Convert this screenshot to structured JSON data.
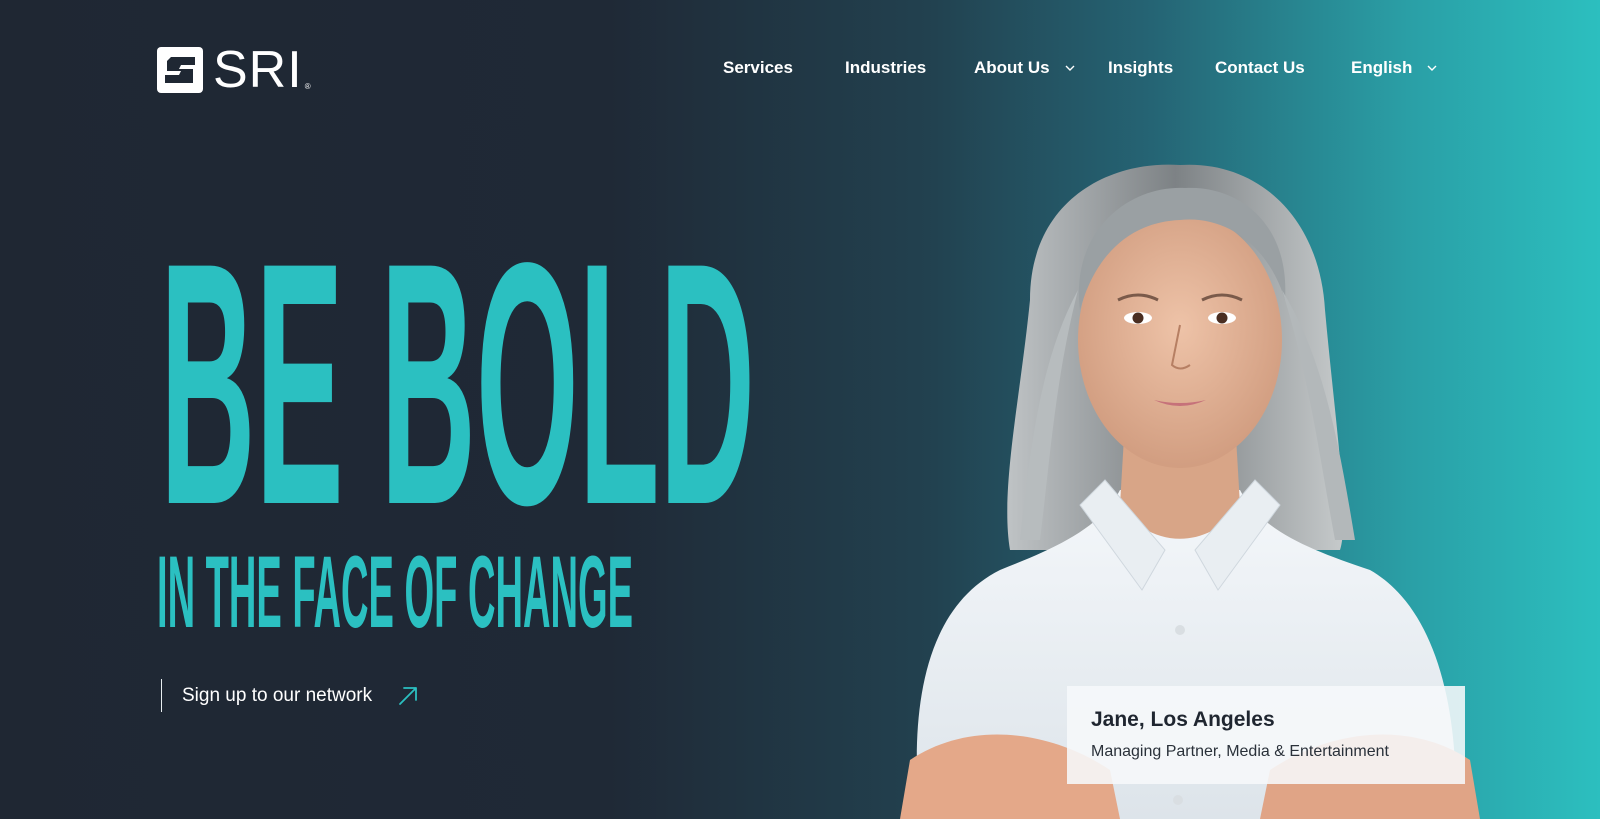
{
  "brand": {
    "name": "SRI",
    "registered_mark": "®"
  },
  "nav": {
    "items": [
      {
        "label": "Services",
        "has_dropdown": false
      },
      {
        "label": "Industries",
        "has_dropdown": false
      },
      {
        "label": "About Us",
        "has_dropdown": true
      },
      {
        "label": "Insights",
        "has_dropdown": false
      },
      {
        "label": "Contact Us",
        "has_dropdown": false
      },
      {
        "label": "English",
        "has_dropdown": true
      }
    ]
  },
  "hero": {
    "headline": "BE BOLD",
    "subheadline": "IN THE FACE OF CHANGE",
    "cta_label": "Sign up to our network",
    "cta_icon": "arrow-up-right-icon"
  },
  "profile_card": {
    "name": "Jane, Los Angeles",
    "role": "Managing Partner, Media & Entertainment"
  },
  "colors": {
    "background_dark": "#1f2733",
    "background_accent": "#2cbfbf",
    "headline": "#2bc0c1",
    "text": "#ffffff"
  }
}
